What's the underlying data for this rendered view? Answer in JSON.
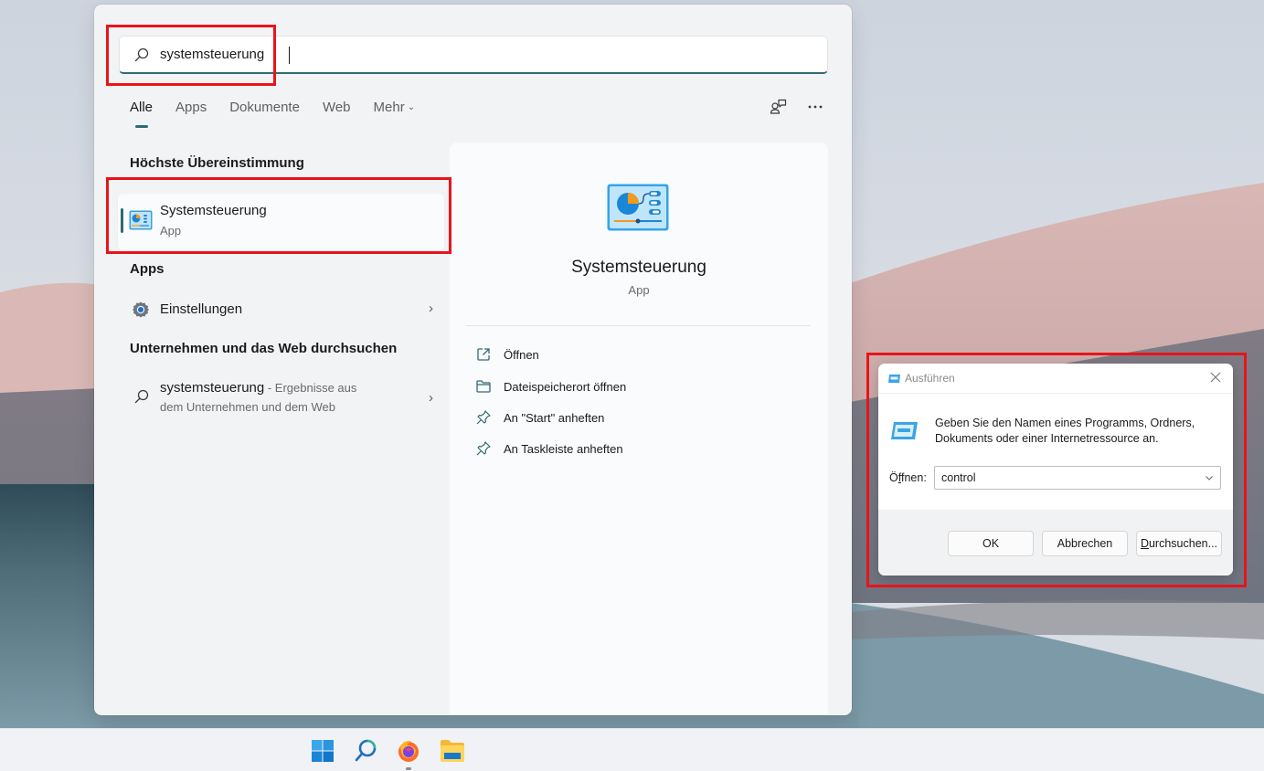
{
  "search": {
    "query": "systemsteuerung",
    "tabs": [
      {
        "label": "Alle",
        "active": true
      },
      {
        "label": "Apps",
        "active": false
      },
      {
        "label": "Dokumente",
        "active": false
      },
      {
        "label": "Web",
        "active": false
      },
      {
        "label": "Mehr",
        "active": false,
        "dropdown": true
      }
    ],
    "actions": {
      "profile_icon": "person-feedback-icon",
      "more_icon": "more-ellipsis-icon",
      "more_label": "···"
    },
    "best_match": {
      "heading": "Höchste Übereinstimmung",
      "name": "Systemsteuerung",
      "type": "App",
      "icon": "control-panel-icon"
    },
    "apps": {
      "heading": "Apps",
      "items": [
        {
          "name": "Einstellungen",
          "icon": "settings-gear-icon"
        }
      ]
    },
    "web": {
      "heading": "Unternehmen und das Web durchsuchen",
      "query": "systemsteuerung",
      "suffix_line1": " - Ergebnisse aus",
      "suffix_line2": "dem Unternehmen und dem Web",
      "icon": "search-icon"
    },
    "detail": {
      "title": "Systemsteuerung",
      "type": "App",
      "actions": [
        {
          "label": "Öffnen",
          "icon": "open-external-icon"
        },
        {
          "label": "Dateispeicherort öffnen",
          "icon": "folder-icon"
        },
        {
          "label": "An \"Start\" anheften",
          "icon": "pin-icon"
        },
        {
          "label": "An Taskleiste anheften",
          "icon": "pin-icon"
        }
      ]
    }
  },
  "run_dialog": {
    "title": "Ausführen",
    "description_line1": "Geben Sie den Namen eines Programms, Ordners,",
    "description_line2": "Dokuments oder einer Internetressource an.",
    "open_label_pre": "Ö",
    "open_label_accel": "f",
    "open_label_post": "fnen:",
    "open_value": "control",
    "buttons": {
      "ok": "OK",
      "cancel": "Abbrechen",
      "browse_accel": "D",
      "browse_rest": "urchsuchen..."
    }
  },
  "taskbar": {
    "items": [
      {
        "name": "Start",
        "icon": "windows-start-icon"
      },
      {
        "name": "Suche",
        "icon": "search-icon",
        "highlighted": true
      },
      {
        "name": "Firefox",
        "icon": "firefox-icon",
        "running": true
      },
      {
        "name": "Explorer",
        "icon": "file-explorer-icon"
      }
    ]
  },
  "colors": {
    "accent": "#2f6b74",
    "highlight_red": "#e8141a",
    "panel_bg": "#f2f3f5",
    "taskbar_bg": "#f1f2f5"
  }
}
